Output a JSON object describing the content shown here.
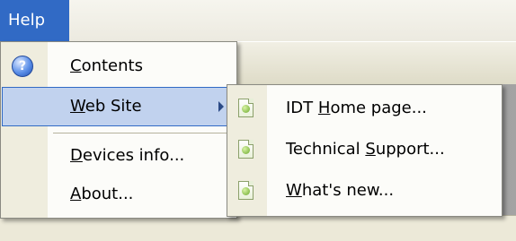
{
  "menubar": {
    "help_label": "Help"
  },
  "main_menu": {
    "items": [
      {
        "pre": "",
        "mnemonic": "C",
        "post": "ontents",
        "icon": "help-icon"
      },
      {
        "pre": "",
        "mnemonic": "W",
        "post": "eb Site",
        "has_submenu": true
      },
      {
        "pre": "",
        "mnemonic": "D",
        "post": "evices info..."
      },
      {
        "pre": "",
        "mnemonic": "A",
        "post": "bout..."
      }
    ]
  },
  "sub_menu": {
    "items": [
      {
        "pre": "IDT ",
        "mnemonic": "H",
        "post": "ome page...",
        "icon": "page-icon"
      },
      {
        "pre": "Technical ",
        "mnemonic": "S",
        "post": "upport...",
        "icon": "page-icon"
      },
      {
        "pre": "",
        "mnemonic": "W",
        "post": "hat's new...",
        "icon": "page-icon"
      }
    ]
  },
  "colors": {
    "selection": "#316ac5",
    "menu_bg": "#fcfcf9",
    "gutter": "#efedde"
  }
}
